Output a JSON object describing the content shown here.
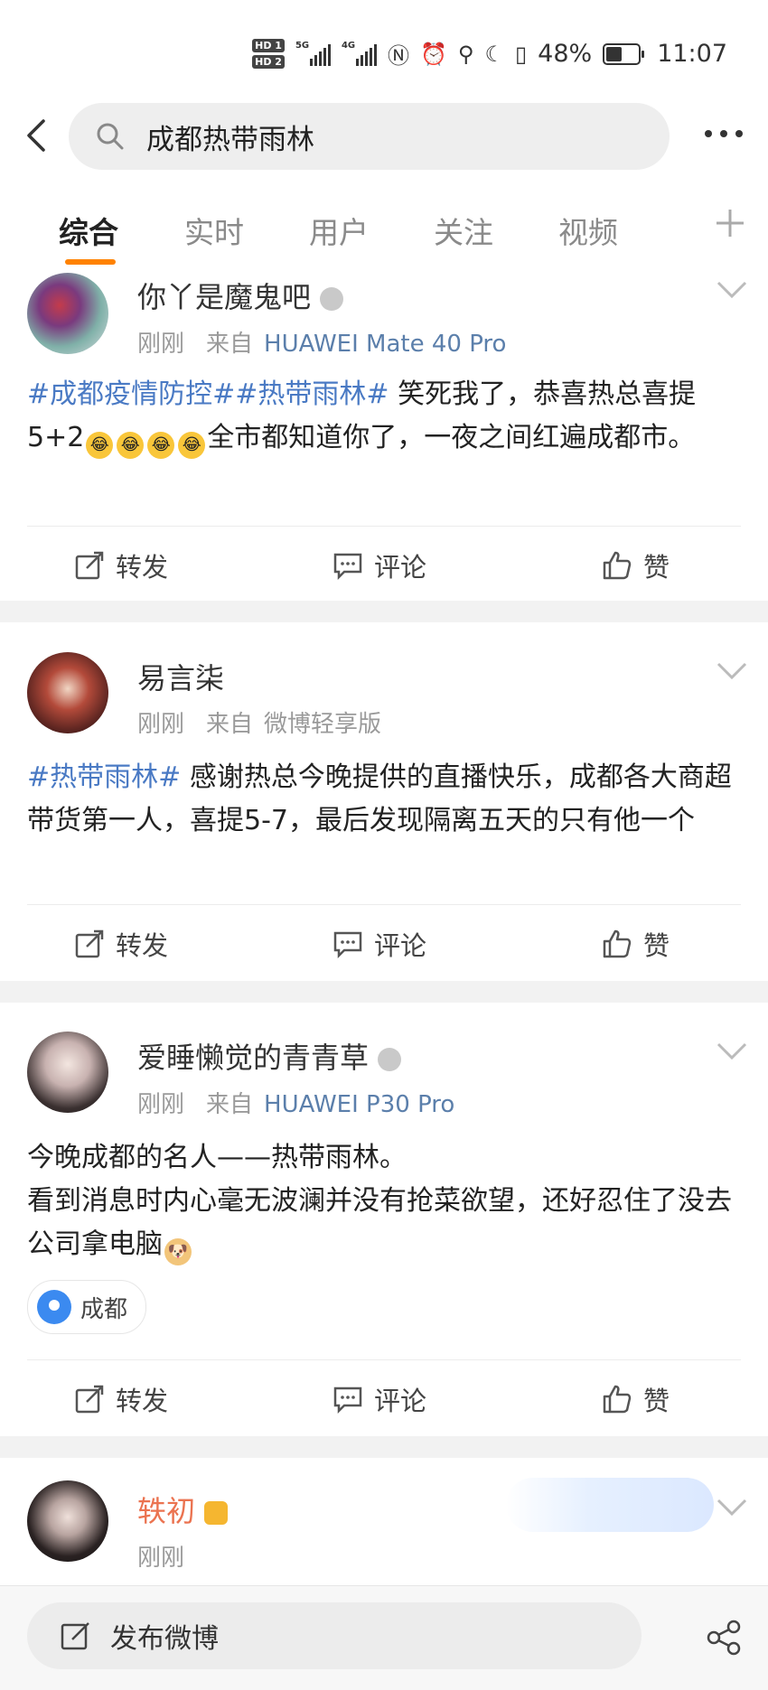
{
  "status": {
    "battery": "48%",
    "time": "11:07",
    "net1": "5G",
    "net2": "4G",
    "hd1": "HD 1",
    "hd2": "HD 2"
  },
  "search": {
    "query": "成都热带雨林"
  },
  "tabs": [
    "综合",
    "实时",
    "用户",
    "关注",
    "视频"
  ],
  "posts": [
    {
      "user": "你丫是魔鬼吧",
      "time": "刚刚",
      "from": "来自",
      "source": "HUAWEI Mate 40 Pro",
      "tag": "#成都疫情防控##热带雨林#",
      "text_a": " 笑死我了，恭喜热总喜提5+2",
      "text_b": "全市都知道你了，一夜之间红遍成都市。"
    },
    {
      "user": "易言柒",
      "time": "刚刚",
      "from": "来自",
      "source": "微博轻享版",
      "tag": "#热带雨林#",
      "text_a": "  感谢热总今晚提供的直播快乐，成都各大商超带货第一人，喜提5-7，最后发现隔离五天的只有他一个"
    },
    {
      "user": "爱睡懒觉的青青草",
      "time": "刚刚",
      "from": "来自",
      "source": "HUAWEI P30 Pro",
      "text_a": "今晚成都的名人——热带雨林。",
      "text_b": "看到消息时内心毫无波澜并没有抢菜欲望，还好忍住了没去公司拿电脑",
      "location": "成都"
    },
    {
      "user": "轶初",
      "time": "刚刚"
    }
  ],
  "actions": {
    "repost": "转发",
    "comment": "评论",
    "like": "赞"
  },
  "bottom": {
    "compose": "发布微博"
  },
  "colors": {
    "accent": "#ff8200",
    "link": "#4a7ac4",
    "source": "#5b7fab"
  }
}
